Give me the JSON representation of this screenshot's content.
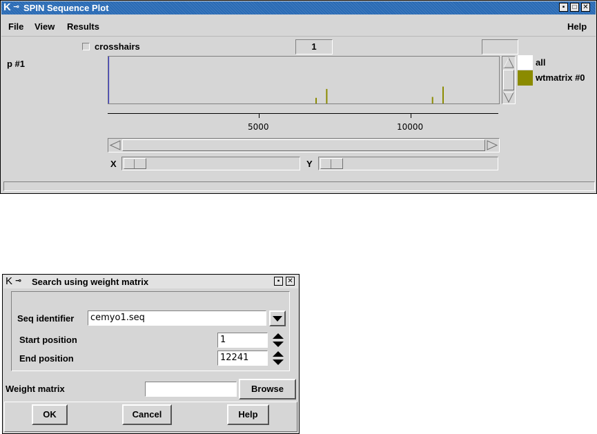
{
  "main_window": {
    "title": "SPIN Sequence Plot",
    "menus": {
      "file": "File",
      "view": "View",
      "results": "Results",
      "help": "Help"
    },
    "crosshairs_label": "crosshairs",
    "counter_value": "1",
    "plot_label": "p #1",
    "x_ticks": [
      "5000",
      "10000"
    ],
    "legend": [
      {
        "label": "all",
        "color": "#ffffff"
      },
      {
        "label": "wtmatrix #0",
        "color": "#8b8b00"
      }
    ],
    "x_label": "X",
    "y_label": "Y",
    "plot_marks": [
      {
        "pos": 6850,
        "height": 0.12
      },
      {
        "pos": 7200,
        "height": 0.31
      },
      {
        "pos": 10700,
        "height": 0.14
      },
      {
        "pos": 11050,
        "height": 0.36
      }
    ],
    "plot_range": [
      0,
      12241
    ]
  },
  "dialog": {
    "title": "Search using weight matrix",
    "seq_identifier_label": "Seq identifier",
    "seq_identifier_value": "cemyo1.seq",
    "start_position_label": "Start position",
    "start_position_value": "1",
    "end_position_label": "End position",
    "end_position_value": "12241",
    "weight_matrix_label": "Weight matrix",
    "weight_matrix_value": "",
    "browse_label": "Browse",
    "ok_label": "OK",
    "cancel_label": "Cancel",
    "help_label": "Help"
  },
  "colors": {
    "title_bar": "#2a6bb5",
    "series": "#8b8b00",
    "window_bg": "#d6d6d6"
  }
}
